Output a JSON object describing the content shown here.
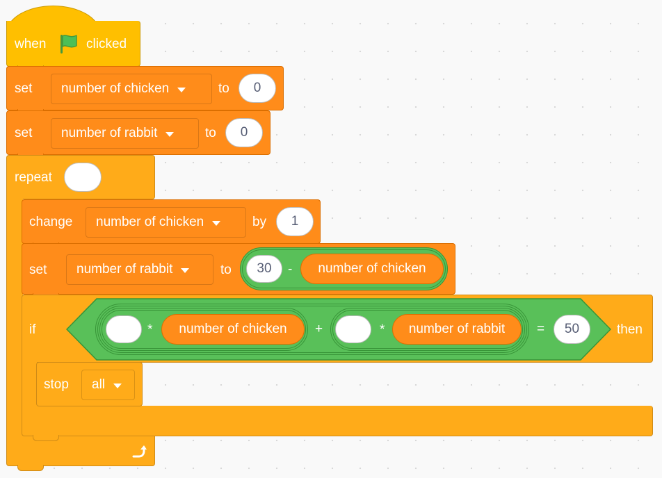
{
  "script": {
    "hat": {
      "when_label": "when",
      "flag_icon": "green-flag-icon",
      "clicked_label": "clicked"
    },
    "set_chicken": {
      "label": "set",
      "variable": "number of chicken",
      "to_label": "to",
      "value": "0"
    },
    "set_rabbit": {
      "label": "set",
      "variable": "number of rabbit",
      "to_label": "to",
      "value": "0"
    },
    "repeat": {
      "label": "repeat",
      "count": ""
    },
    "change_chicken": {
      "label": "change",
      "variable": "number of chicken",
      "by_label": "by",
      "value": "1"
    },
    "set_rabbit_calc": {
      "label": "set",
      "variable": "number of rabbit",
      "to_label": "to",
      "left_value": "30",
      "operator": "-",
      "right_reporter": "number of chicken"
    },
    "if_block": {
      "if_label": "if",
      "then_label": "then",
      "mult1": {
        "value": "",
        "operator": "*",
        "reporter": "number of chicken"
      },
      "plus_operator": "+",
      "mult2": {
        "value": "",
        "operator": "*",
        "reporter": "number of rabbit"
      },
      "equals_operator": "=",
      "compare_value": "50"
    },
    "stop": {
      "label": "stop",
      "option": "all"
    },
    "loop_icon": "loop-arrow-icon"
  },
  "colors": {
    "events": "#ffbf00",
    "variables": "#ff8c1a",
    "control": "#ffab19",
    "operators": "#59c059",
    "canvas": "#f9f9f9"
  }
}
